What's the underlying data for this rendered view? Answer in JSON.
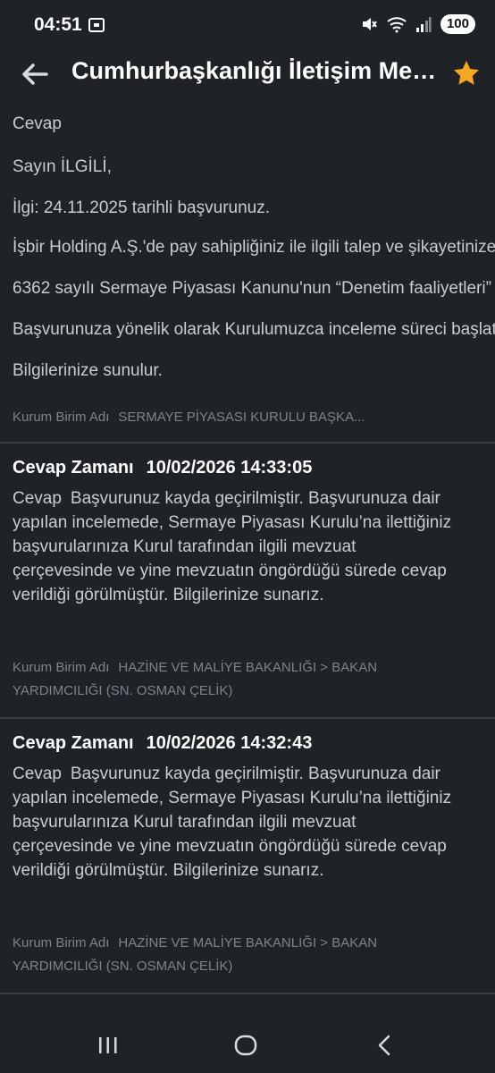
{
  "status": {
    "time": "04:51",
    "battery": "100"
  },
  "appbar": {
    "title": "Cumhurbaşkanlığı İletişim Merkezi"
  },
  "first_answer": {
    "label": "Cevap",
    "lines": [
      "Sayın İLGİLİ,",
      "İlgi: 24.11.2025 tarihli başvurunuz.",
      "İşbir Holding A.Ş.'de pay sahipliğiniz ile ilgili talep ve şikayetinize",
      "6362 sayılı Sermaye Piyasası Kanunu'nun “Denetim faaliyetleri”",
      "Başvurunuza yönelik olarak Kurulumuzca inceleme süreci başlatılmış",
      "Bilgilerinize sunulur."
    ],
    "unit_label": "Kurum Birim Adı",
    "unit_value": "SERMAYE PİYASASI KURULU BAŞKA..."
  },
  "answers": [
    {
      "time_label": "Cevap Zamanı",
      "timestamp": "10/02/2026 14:33:05",
      "label": "Cevap",
      "text": "Başvurunuz kayda geçirilmiştir. Başvurunuza dair yapılan incelemede, Sermaye Piyasası Kurulu’na ilettiğiniz başvurularınıza Kurul tarafından ilgili mevzuat çerçevesinde ve yine mevzuatın öngördüğü sürede cevap verildiği görülmüştür. Bilgilerinize sunarız.",
      "unit_label": "Kurum Birim Adı",
      "unit_value": "HAZİNE VE MALİYE BAKANLIĞI > BAKAN YARDIMCILIĞI (SN. OSMAN ÇELİK)"
    },
    {
      "time_label": "Cevap Zamanı",
      "timestamp": "10/02/2026 14:32:43",
      "label": "Cevap",
      "text": "Başvurunuz kayda geçirilmiştir. Başvurunuza dair yapılan incelemede, Sermaye Piyasası Kurulu’na ilettiğiniz başvurularınıza Kurul tarafından ilgili mevzuat çerçevesinde ve yine mevzuatın öngördüğü sürede cevap verildiği görülmüştür. Bilgilerinize sunarız.",
      "unit_label": "Kurum Birim Adı",
      "unit_value": "HAZİNE VE MALİYE BAKANLIĞI > BAKAN YARDIMCILIĞI (SN. OSMAN ÇELİK)"
    }
  ],
  "icons": {
    "back": "arrow-left-icon",
    "favorite": "star-icon",
    "nav_recent": "recent-apps-icon",
    "nav_home": "home-icon",
    "nav_back": "chevron-left-icon"
  },
  "colors": {
    "background": "#1f2327",
    "star": "#f5a623",
    "text": "#c9ccd0",
    "muted": "#7d838a"
  }
}
